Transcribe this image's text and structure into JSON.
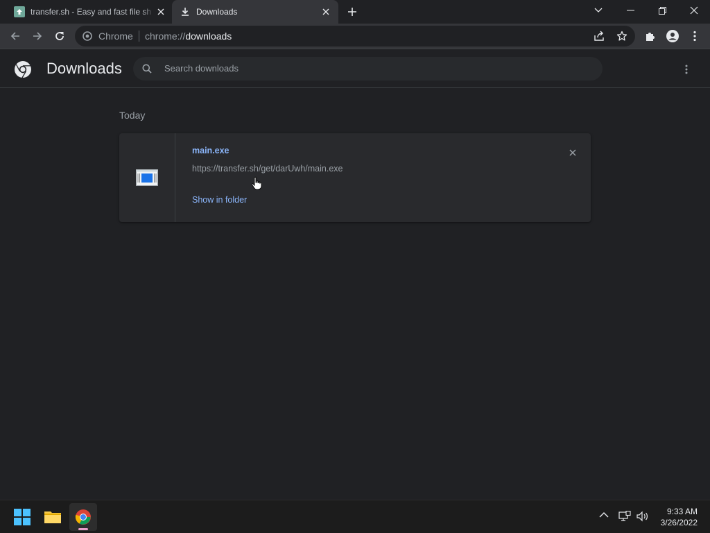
{
  "tabs": [
    {
      "title": "transfer.sh - Easy and fast file sharing from the command-line.",
      "favicon": "transfer-upload-icon"
    },
    {
      "title": "Downloads",
      "favicon": "download-icon"
    }
  ],
  "omnibox": {
    "chip": "Chrome",
    "url_prefix": "chrome://",
    "url_host": "downloads"
  },
  "page": {
    "title": "Downloads",
    "search_placeholder": "Search downloads"
  },
  "downloads": {
    "section_label": "Today",
    "items": [
      {
        "filename": "main.exe",
        "url": "https://transfer.sh/get/darUwh/main.exe",
        "action": "Show in folder",
        "file_icon": "exe-file-icon"
      }
    ]
  },
  "taskbar": {
    "time": "9:33 AM",
    "date": "3/26/2022"
  },
  "colors": {
    "accent_link": "#8ab4f8",
    "background": "#202124",
    "card": "#292a2d",
    "toolbar": "#35363a"
  }
}
